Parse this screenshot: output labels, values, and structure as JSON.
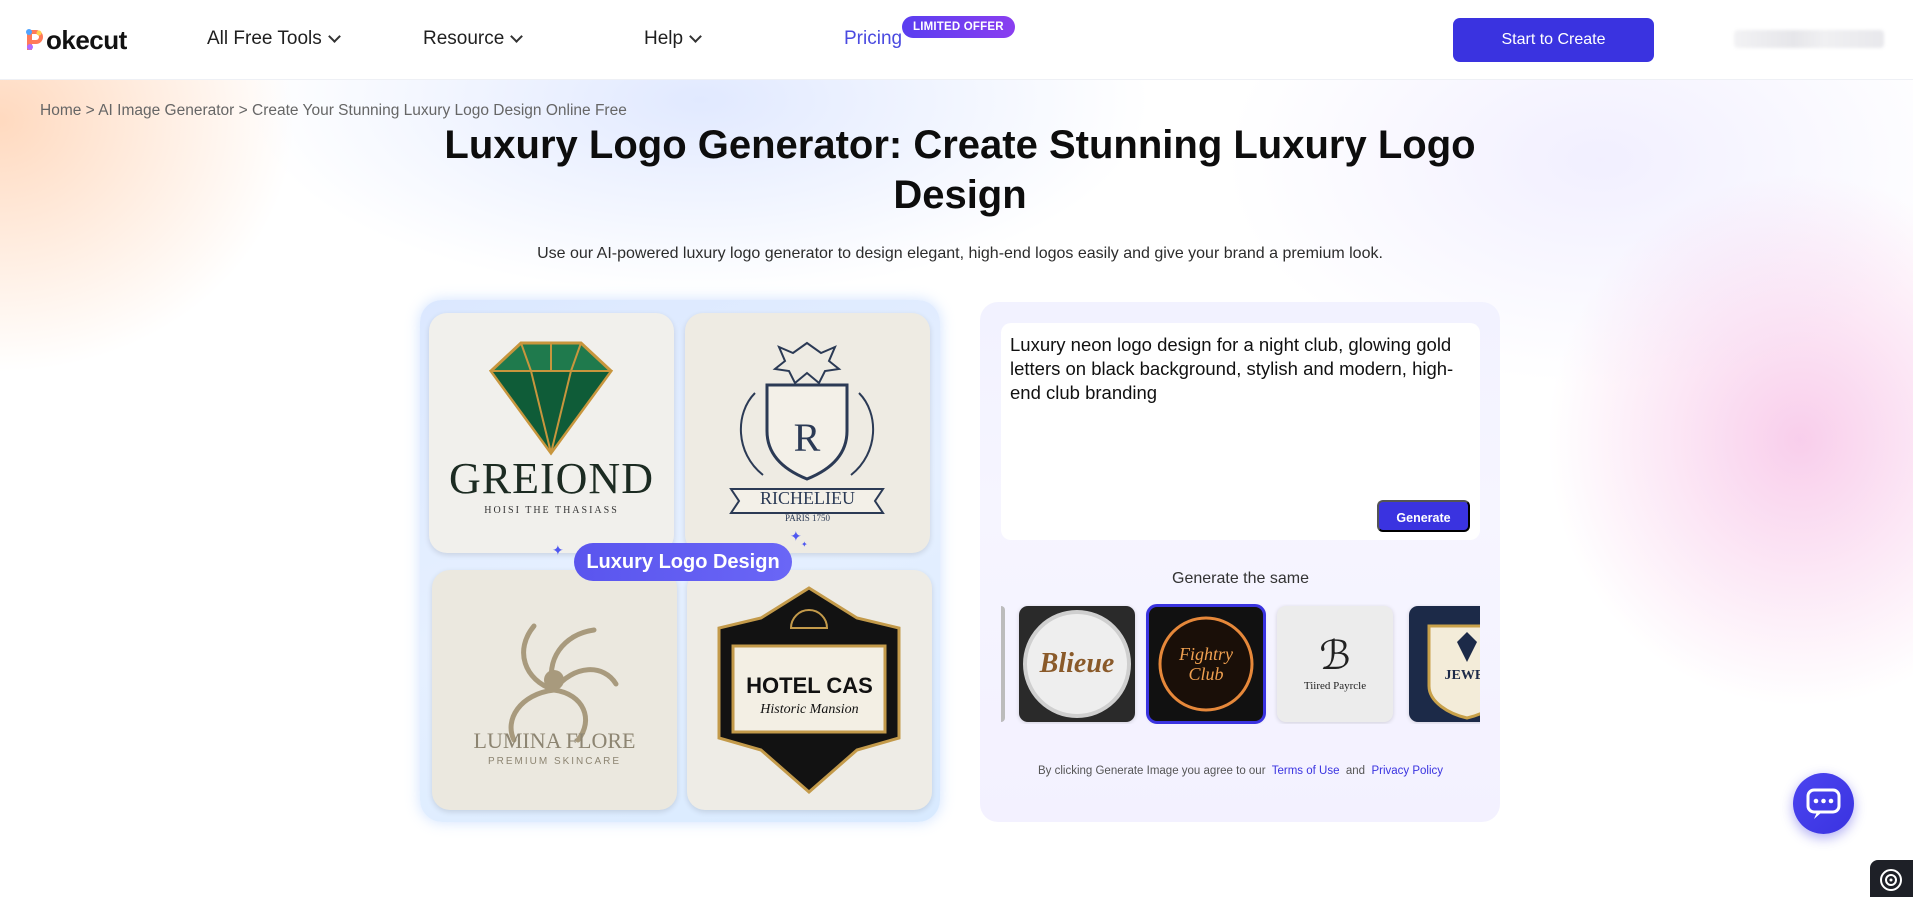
{
  "header": {
    "logo_text": "okecut",
    "nav": {
      "all_tools": "All Free Tools",
      "resource": "Resource",
      "help": "Help",
      "pricing": "Pricing"
    },
    "badge": "LIMITED OFFER",
    "start_button": "Start to Create"
  },
  "breadcrumb": {
    "home": "Home",
    "sep": ">",
    "ai_image": "AI Image Generator",
    "current": "Create Your Stunning Luxury Logo Design Online Free"
  },
  "hero": {
    "title": "Luxury Logo Generator: Create Stunning Luxury Logo Design",
    "subtitle": "Use our AI-powered luxury logo generator to design elegant, high-end logos easily and give your brand a premium look."
  },
  "showcase": {
    "pill_label": "Luxury Logo Design",
    "cards": [
      {
        "title": "GREIOND",
        "sub": "HOISI THE THASIASS"
      },
      {
        "title": "RICHELIEU",
        "sub": "PARIS 1750"
      },
      {
        "title": "LUMINA FLORE",
        "sub": "PREMIUM SKINCARE"
      },
      {
        "title": "HOTEL CAS",
        "sub": "Historic Mansion"
      }
    ]
  },
  "generator": {
    "prompt": "Luxury neon logo design for a night club, glowing gold letters on black background, stylish and modern, high-end club branding",
    "generate_button": "Generate",
    "same_label": "Generate the same",
    "thumbs": [
      {
        "label": "Blieue"
      },
      {
        "label": "Fightry Club"
      },
      {
        "label": "Tiired Payrcle"
      },
      {
        "label": "JEWEL"
      }
    ],
    "terms_prefix": "By clicking Generate Image you agree to our",
    "terms_link": "Terms of Use",
    "terms_and": "and",
    "privacy_link": "Privacy Policy"
  },
  "colors": {
    "accent": "#3a33e0",
    "badge": "#6a3ef0",
    "pricing": "#4a4ae0"
  }
}
